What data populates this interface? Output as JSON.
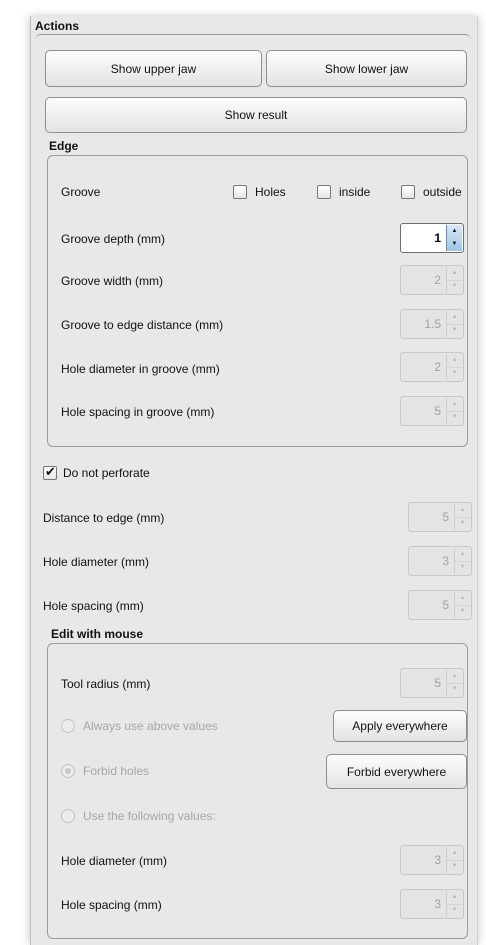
{
  "actions": {
    "title": "Actions",
    "show_upper_jaw": "Show upper jaw",
    "show_lower_jaw": "Show lower jaw",
    "show_result": "Show result"
  },
  "edge": {
    "title": "Edge",
    "groove_label": "Groove",
    "holes_label": "Holes",
    "inside_label": "inside",
    "outside_label": "outside",
    "rows": [
      {
        "label": "Groove depth (mm)",
        "value": "1"
      },
      {
        "label": "Groove width (mm)",
        "value": "2"
      },
      {
        "label": "Groove to edge distance (mm)",
        "value": "1.5"
      },
      {
        "label": "Hole diameter in groove (mm)",
        "value": "2"
      },
      {
        "label": "Hole spacing in groove (mm)",
        "value": "5"
      }
    ]
  },
  "perforate": {
    "label": "Do not perforate",
    "checked": true,
    "rows": [
      {
        "label": "Distance to edge (mm)",
        "value": "5"
      },
      {
        "label": "Hole diameter (mm)",
        "value": "3"
      },
      {
        "label": "Hole spacing (mm)",
        "value": "5"
      }
    ]
  },
  "mouse": {
    "title": "Edit with mouse",
    "tool_radius_label": "Tool radius (mm)",
    "tool_radius_value": "5",
    "always_label": "Always use above values",
    "apply_button": "Apply everywhere",
    "forbid_label": "Forbid holes",
    "forbid_button": "Forbid everywhere",
    "following_label": "Use the following values:",
    "rows": [
      {
        "label": "Hole diameter (mm)",
        "value": "3"
      },
      {
        "label": "Hole spacing (mm)",
        "value": "3"
      }
    ]
  }
}
